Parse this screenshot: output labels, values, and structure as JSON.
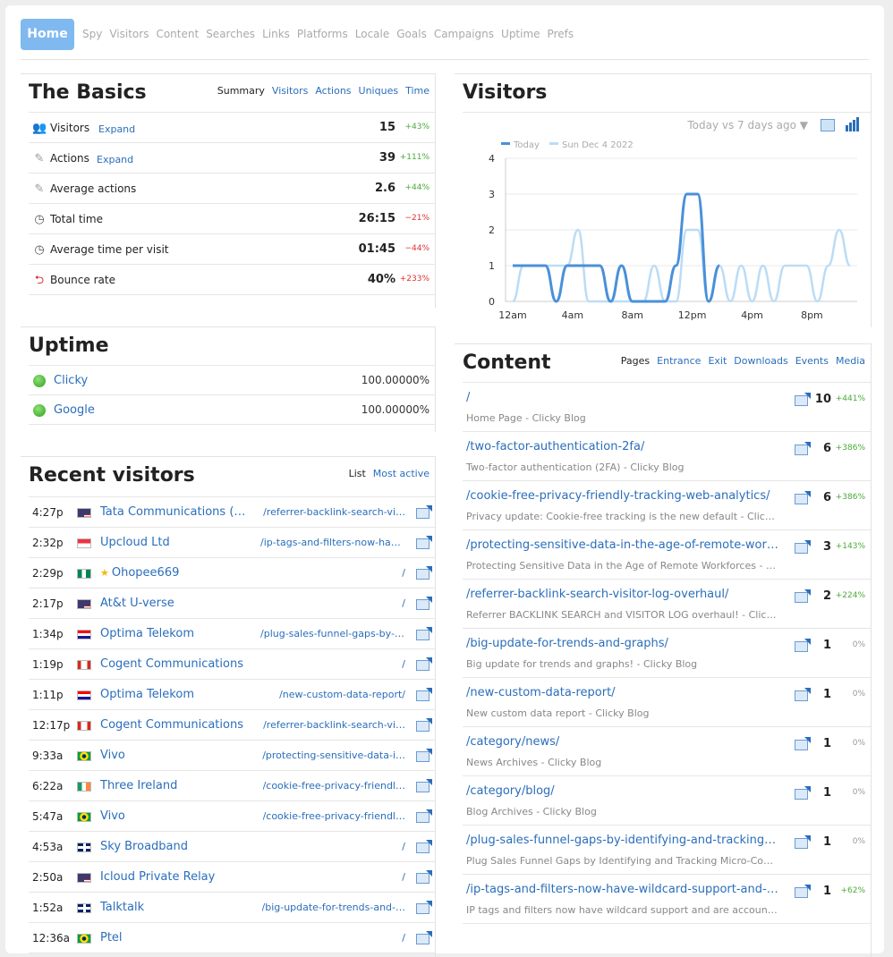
{
  "nav": {
    "home": "Home",
    "items": [
      "Spy",
      "Visitors",
      "Content",
      "Searches",
      "Links",
      "Platforms",
      "Locale",
      "Goals",
      "Campaigns",
      "Uptime",
      "Prefs"
    ]
  },
  "basics": {
    "title": "The Basics",
    "tabs": [
      "Summary",
      "Visitors",
      "Actions",
      "Uniques",
      "Time"
    ],
    "rows": [
      {
        "icon": "visitors-icon",
        "label": "Visitors",
        "expand": "Expand",
        "value": "15",
        "change": "+43%",
        "dir": "up"
      },
      {
        "icon": "actions-icon",
        "label": "Actions",
        "expand": "Expand",
        "value": "39",
        "change": "+111%",
        "dir": "up"
      },
      {
        "icon": "actions-icon",
        "label": "Average actions",
        "expand": "",
        "value": "2.6",
        "change": "+44%",
        "dir": "up"
      },
      {
        "icon": "clock-icon",
        "label": "Total time",
        "expand": "",
        "value": "26:15",
        "change": "−21%",
        "dir": "down"
      },
      {
        "icon": "clock-icon",
        "label": "Average time per visit",
        "expand": "",
        "value": "01:45",
        "change": "−44%",
        "dir": "down"
      },
      {
        "icon": "bounce-icon",
        "label": "Bounce rate",
        "expand": "",
        "value": "40%",
        "change": "+233%",
        "dir": "down"
      }
    ]
  },
  "uptime": {
    "title": "Uptime",
    "rows": [
      {
        "name": "Clicky",
        "pct": "100.00000%"
      },
      {
        "name": "Google",
        "pct": "100.00000%"
      }
    ]
  },
  "recent": {
    "title": "Recent visitors",
    "tabs": [
      "List",
      "Most active"
    ],
    "rows": [
      {
        "time": "4:27p",
        "flag": "us",
        "org": "Tata Communications (am…",
        "page": "/referrer-backlink-search-vi…",
        "star": false
      },
      {
        "time": "2:32p",
        "flag": "sg",
        "org": "Upcloud Ltd",
        "page": "/ip-tags-and-filters-now-hav…",
        "star": false
      },
      {
        "time": "2:29p",
        "flag": "ng",
        "org": "Ohopee669",
        "page": "/",
        "star": true
      },
      {
        "time": "2:17p",
        "flag": "us",
        "org": "At&t U-verse",
        "page": "/",
        "star": false
      },
      {
        "time": "1:34p",
        "flag": "hr",
        "org": "Optima Telekom",
        "page": "/plug-sales-funnel-gaps-by-i…",
        "star": false
      },
      {
        "time": "1:19p",
        "flag": "ca",
        "org": "Cogent Communications",
        "page": "/",
        "star": false
      },
      {
        "time": "1:11p",
        "flag": "hr",
        "org": "Optima Telekom",
        "page": "/new-custom-data-report/",
        "star": false
      },
      {
        "time": "12:17p",
        "flag": "ca",
        "org": "Cogent Communications",
        "page": "/referrer-backlink-search-vi…",
        "star": false
      },
      {
        "time": "9:33a",
        "flag": "br",
        "org": "Vivo",
        "page": "/protecting-sensitive-data-i…",
        "star": false
      },
      {
        "time": "6:22a",
        "flag": "ie",
        "org": "Three Ireland",
        "page": "/cookie-free-privacy-friendl…",
        "star": false
      },
      {
        "time": "5:47a",
        "flag": "br",
        "org": "Vivo",
        "page": "/cookie-free-privacy-friendl…",
        "star": false
      },
      {
        "time": "4:53a",
        "flag": "gb",
        "org": "Sky Broadband",
        "page": "/",
        "star": false
      },
      {
        "time": "2:50a",
        "flag": "us",
        "org": "Icloud Private Relay",
        "page": "/",
        "star": false
      },
      {
        "time": "1:52a",
        "flag": "gb",
        "org": "Talktalk",
        "page": "/big-update-for-trends-and-…",
        "star": false
      },
      {
        "time": "12:36a",
        "flag": "br",
        "org": "Ptel",
        "page": "/",
        "star": false
      }
    ]
  },
  "visitors_chart": {
    "title": "Visitors",
    "compare": "Today vs 7 days ago ▼",
    "colors": {
      "today": "#4a90d9",
      "previous": "#bcdcf5"
    }
  },
  "chart_data": {
    "type": "line",
    "series": [
      {
        "name": "Today",
        "values": [
          1,
          1,
          1,
          1,
          0,
          1,
          1,
          1,
          1,
          0,
          1,
          0,
          0,
          0,
          0,
          1,
          3,
          3,
          0,
          1,
          null,
          null,
          null,
          null,
          null,
          null,
          null,
          null,
          null,
          null,
          null,
          null
        ]
      },
      {
        "name": "Sun Dec 4 2022",
        "values": [
          0,
          1,
          1,
          1,
          1,
          1,
          2,
          0,
          0,
          0,
          0,
          0,
          0,
          1,
          0,
          0,
          2,
          2,
          0,
          1,
          0,
          1,
          0,
          1,
          0,
          1,
          1,
          1,
          0,
          1,
          2,
          1
        ]
      }
    ],
    "x_tick_labels": [
      "12am",
      "4am",
      "8am",
      "12pm",
      "4pm",
      "8pm"
    ],
    "y_tick_labels": [
      "0",
      "1",
      "2",
      "3",
      "4"
    ],
    "ylim": [
      0,
      4
    ]
  },
  "content": {
    "title": "Content",
    "tabs": [
      "Pages",
      "Entrance",
      "Exit",
      "Downloads",
      "Events",
      "Media"
    ],
    "rows": [
      {
        "path": "/",
        "title": "Home Page - Clicky Blog",
        "value": "10",
        "change": "+441%",
        "dir": "up"
      },
      {
        "path": "/two-factor-authentication-2fa/",
        "title": "Two-factor authentication (2FA) - Clicky Blog",
        "value": "6",
        "change": "+386%",
        "dir": "up"
      },
      {
        "path": "/cookie-free-privacy-friendly-tracking-web-analytics/",
        "title": "Privacy update: Cookie-free tracking is the new default - Click…",
        "value": "6",
        "change": "+386%",
        "dir": "up"
      },
      {
        "path": "/protecting-sensitive-data-in-the-age-of-remote-workfor…",
        "title": "Protecting Sensitive Data in the Age of Remote Workforces - Cl…",
        "value": "3",
        "change": "+143%",
        "dir": "up"
      },
      {
        "path": "/referrer-backlink-search-visitor-log-overhaul/",
        "title": "Referrer BACKLINK SEARCH and VISITOR LOG overhaul! - Clicky…",
        "value": "2",
        "change": "+224%",
        "dir": "up"
      },
      {
        "path": "/big-update-for-trends-and-graphs/",
        "title": "Big update for trends and graphs! - Clicky Blog",
        "value": "1",
        "change": "0%",
        "dir": "zero"
      },
      {
        "path": "/new-custom-data-report/",
        "title": "New custom data report - Clicky Blog",
        "value": "1",
        "change": "0%",
        "dir": "zero"
      },
      {
        "path": "/category/news/",
        "title": "News Archives - Clicky Blog",
        "value": "1",
        "change": "0%",
        "dir": "zero"
      },
      {
        "path": "/category/blog/",
        "title": "Blog Archives - Clicky Blog",
        "value": "1",
        "change": "0%",
        "dir": "zero"
      },
      {
        "path": "/plug-sales-funnel-gaps-by-identifying-and-tracking-micr…",
        "title": "Plug Sales Funnel Gaps by Identifying and Tracking Micro-Conv…",
        "value": "1",
        "change": "0%",
        "dir": "zero"
      },
      {
        "path": "/ip-tags-and-filters-now-have-wildcard-support-and-are-a…",
        "title": "IP tags and filters now have wildcard support and are account …",
        "value": "1",
        "change": "+62%",
        "dir": "up"
      }
    ]
  }
}
